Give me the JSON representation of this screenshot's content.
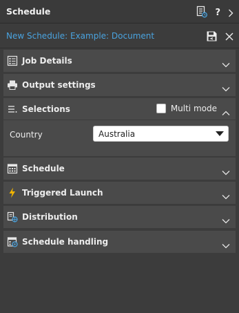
{
  "panel": {
    "title": "Schedule"
  },
  "subheader": {
    "doc_title": "New Schedule: Example: Document"
  },
  "sections": {
    "job_details": "Job Details",
    "output_settings": "Output settings",
    "selections": "Selections",
    "schedule": "Schedule",
    "triggered_launch": "Triggered Launch",
    "distribution": "Distribution",
    "schedule_handling": "Schedule handling"
  },
  "selections": {
    "multi_mode_label": "Multi mode",
    "multi_mode_checked": false,
    "country_label": "Country",
    "country_value": "Australia"
  },
  "colors": {
    "accent": "#4aa3df",
    "lightning": "#f0b400"
  }
}
